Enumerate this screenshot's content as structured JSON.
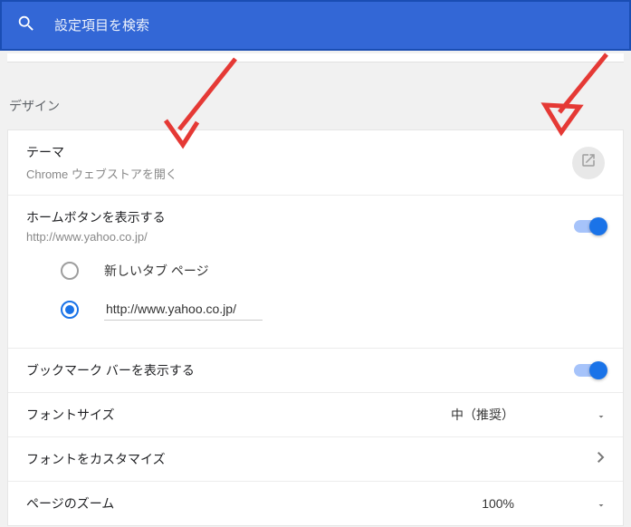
{
  "header": {
    "search_placeholder": "設定項目を検索"
  },
  "section": {
    "title": "デザイン"
  },
  "theme": {
    "label": "テーマ",
    "sub": "Chrome ウェブストアを開く"
  },
  "home_button": {
    "label": "ホームボタンを表示する",
    "sub": "http://www.yahoo.co.jp/",
    "options": {
      "new_tab": "新しいタブ ページ",
      "custom_url": "http://www.yahoo.co.jp/"
    }
  },
  "bookmark_bar": {
    "label": "ブックマーク バーを表示する"
  },
  "font_size": {
    "label": "フォントサイズ",
    "value": "中（推奨）"
  },
  "font_customize": {
    "label": "フォントをカスタマイズ"
  },
  "page_zoom": {
    "label": "ページのズーム",
    "value": "100%"
  }
}
